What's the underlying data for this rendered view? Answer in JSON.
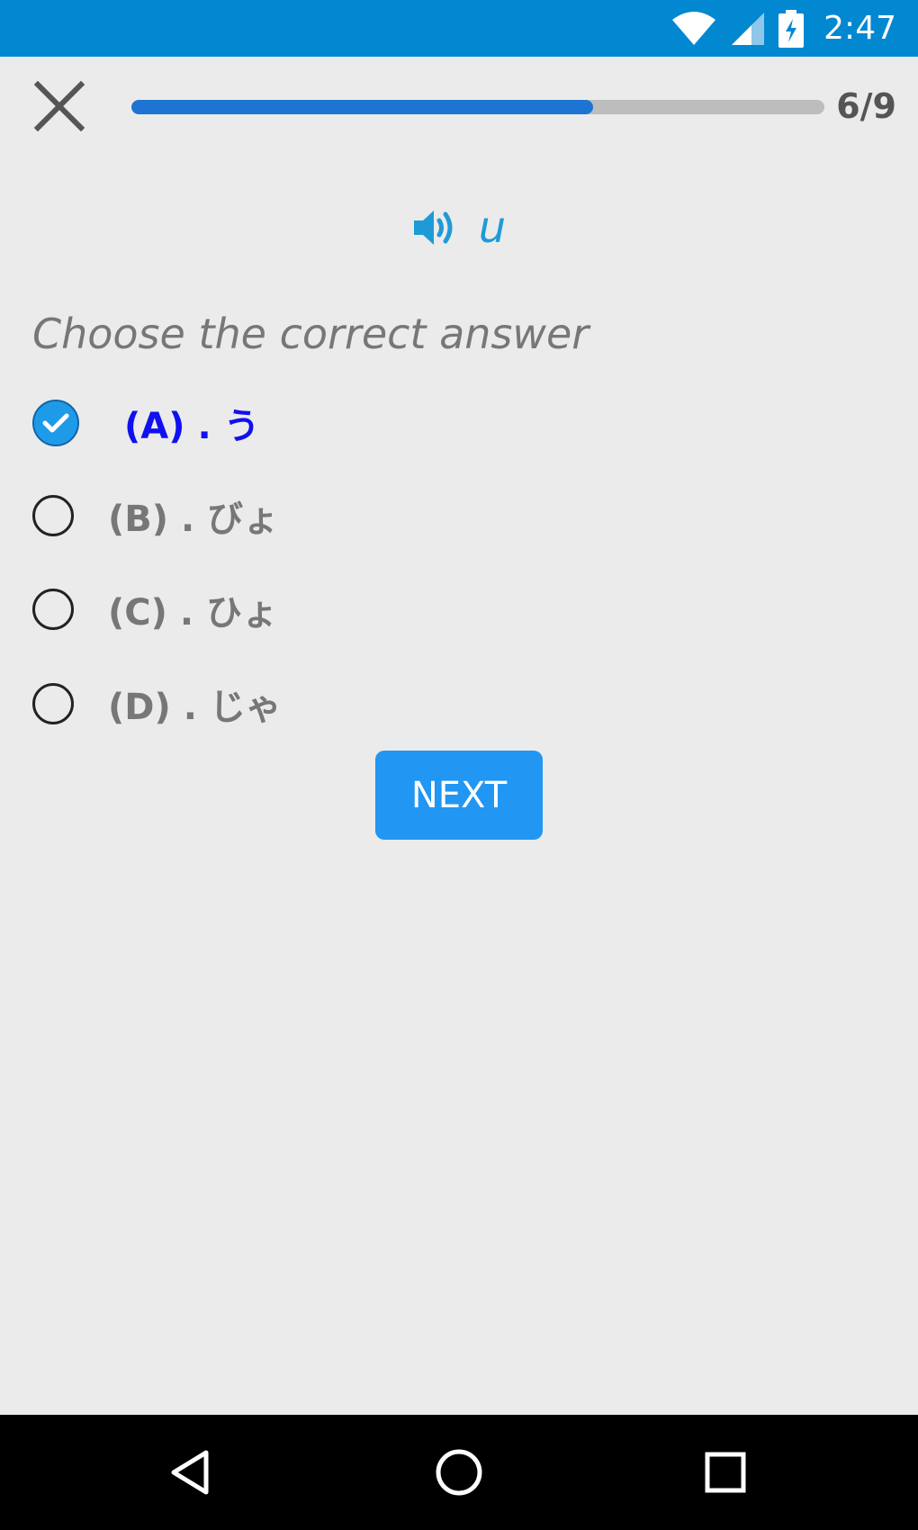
{
  "status_bar": {
    "time": "2:47",
    "icons": [
      "wifi-icon",
      "signal-icon",
      "battery-charging-icon"
    ],
    "color": "#0288d1"
  },
  "header": {
    "close_icon": "close-icon",
    "progress_current": 6,
    "progress_total": 9,
    "progress_fraction": 0.6667,
    "progress_label": "6/9"
  },
  "prompt": {
    "icon": "speaker-icon",
    "text": "u"
  },
  "question": "Choose the correct answer",
  "options": [
    {
      "label": "(A) . う",
      "selected": true
    },
    {
      "label": "(B) . びょ",
      "selected": false
    },
    {
      "label": "(C) . ひょ",
      "selected": false
    },
    {
      "label": "(D) . じゃ",
      "selected": false
    }
  ],
  "next_button": {
    "label": "NEXT",
    "color": "#2196f3"
  },
  "nav_bar": {
    "buttons": [
      "back-icon",
      "home-icon",
      "recents-icon"
    ]
  },
  "colors": {
    "accent": "#1e9bd7",
    "selected_text": "#1010f0",
    "progress_fill": "#1e74d2"
  }
}
